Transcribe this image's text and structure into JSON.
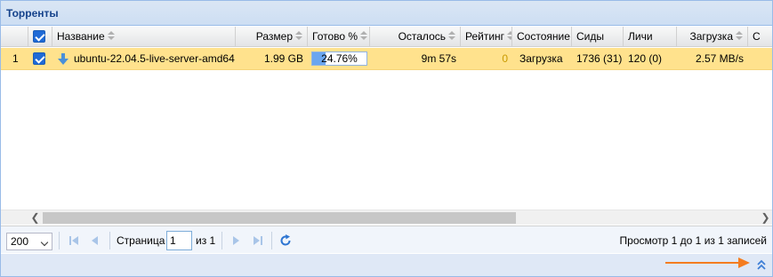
{
  "panel": {
    "title": "Торренты"
  },
  "columns": {
    "name": "Название",
    "size": "Размер",
    "done": "Готово %",
    "remaining": "Осталось",
    "rating": "Рейтинг",
    "status": "Состояние",
    "seeds": "Сиды",
    "peers": "Личи",
    "download": "Загрузка",
    "next_partial": "С"
  },
  "rows": [
    {
      "index": "1",
      "checked": true,
      "name": "ubuntu-22.04.5-live-server-amd64",
      "size": "1.99 GB",
      "done": "24.76%",
      "done_fraction": 0.2476,
      "remaining": "9m 57s",
      "rating": "0",
      "status": "Загрузка",
      "seeds": "1736 (31)",
      "peers": "120 (0)",
      "download": "2.57 MB/s"
    }
  ],
  "pager": {
    "page_size": "200",
    "page_label": "Страница",
    "page_value": "1",
    "of_label": "из 1",
    "display_msg": "Просмотр 1 до 1 из 1 записей"
  },
  "colors": {
    "selected_row": "#ffe28d",
    "progress": "#6aa6ef",
    "annotation_arrow": "#f47c20",
    "header_title": "#15428b"
  },
  "icons": {
    "row_status": "download-arrow-icon",
    "first_page": "first-page-icon",
    "prev_page": "prev-page-icon",
    "next_page": "next-page-icon",
    "last_page": "last-page-icon",
    "refresh": "refresh-icon",
    "expand": "double-chevron-up-icon"
  }
}
